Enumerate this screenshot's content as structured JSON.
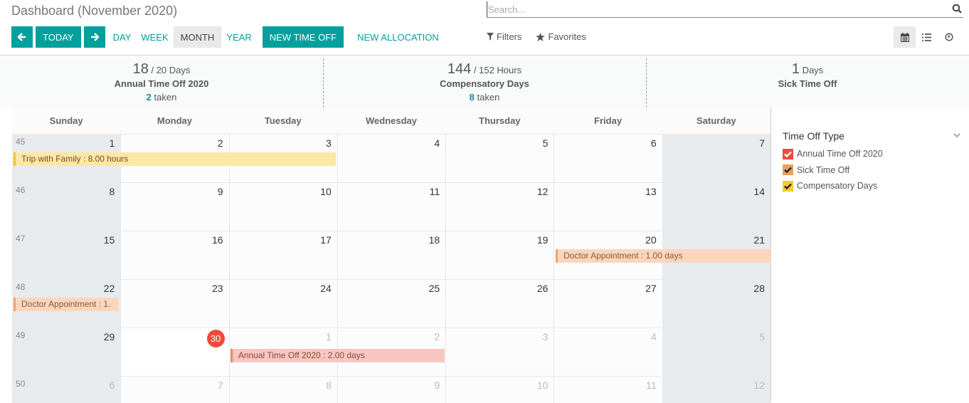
{
  "header": {
    "title": "Dashboard (November 2020)",
    "prev_label": "←",
    "today_label": "TODAY",
    "next_label": "→",
    "views": [
      "DAY",
      "WEEK",
      "MONTH",
      "YEAR"
    ],
    "active_view": "MONTH",
    "new_time_off_label": "NEW TIME OFF",
    "new_allocation_label": "NEW ALLOCATION"
  },
  "search": {
    "placeholder": "Search...",
    "value": ""
  },
  "filters": {
    "filters_label": "Filters",
    "favorites_label": "Favorites"
  },
  "view_switcher": {
    "items": [
      "calendar",
      "list",
      "activity"
    ],
    "active": "calendar"
  },
  "summary": [
    {
      "value": "18",
      "suffix": "/ 20 Days",
      "title": "Annual Time Off 2020",
      "taken": "2",
      "taken_label": "taken"
    },
    {
      "value": "144",
      "suffix": "/ 152 Hours",
      "title": "Compensatory Days",
      "taken": "8",
      "taken_label": "taken"
    },
    {
      "value": "1",
      "suffix": "Days",
      "title": "Sick Time Off",
      "taken": "",
      "taken_label": ""
    }
  ],
  "calendar": {
    "weekdays": [
      "Sunday",
      "Monday",
      "Tuesday",
      "Wednesday",
      "Thursday",
      "Friday",
      "Saturday"
    ],
    "weeks": [
      {
        "number": "45",
        "days": [
          "1",
          "2",
          "3",
          "4",
          "5",
          "6",
          "7"
        ],
        "other": [
          false,
          false,
          false,
          false,
          false,
          false,
          false
        ]
      },
      {
        "number": "46",
        "days": [
          "8",
          "9",
          "10",
          "11",
          "12",
          "13",
          "14"
        ],
        "other": [
          false,
          false,
          false,
          false,
          false,
          false,
          false
        ]
      },
      {
        "number": "47",
        "days": [
          "15",
          "16",
          "17",
          "18",
          "19",
          "20",
          "21"
        ],
        "other": [
          false,
          false,
          false,
          false,
          false,
          false,
          false
        ]
      },
      {
        "number": "48",
        "days": [
          "22",
          "23",
          "24",
          "25",
          "26",
          "27",
          "28"
        ],
        "other": [
          false,
          false,
          false,
          false,
          false,
          false,
          false
        ]
      },
      {
        "number": "49",
        "days": [
          "29",
          "30",
          "1",
          "2",
          "3",
          "4",
          "5"
        ],
        "other": [
          false,
          false,
          true,
          true,
          true,
          true,
          true
        ]
      },
      {
        "number": "50",
        "days": [
          "6",
          "7",
          "8",
          "9",
          "10",
          "11",
          "12"
        ],
        "other": [
          true,
          true,
          true,
          true,
          true,
          true,
          true
        ]
      }
    ],
    "today": "30",
    "events": [
      {
        "label": "Trip with Family : 8.00 hours",
        "color": "yellow",
        "week": 0,
        "start": 0,
        "span": 3
      },
      {
        "label": "Doctor Appointment : 1.00 days",
        "color": "orange",
        "week": 2,
        "start": 5,
        "span": 2
      },
      {
        "label": "Doctor Appointment : 1.",
        "color": "orange",
        "week": 3,
        "start": 0,
        "span": 1
      },
      {
        "label": "Annual Time Off 2020 : 2.00 days",
        "color": "red",
        "week": 4,
        "start": 2,
        "span": 2
      }
    ]
  },
  "sidebar": {
    "title": "Time Off Type",
    "items": [
      {
        "label": "Annual Time Off 2020",
        "color": "#ef4b3b",
        "check_color": "#ffffff",
        "checked": true
      },
      {
        "label": "Sick Time Off",
        "color": "#e8a05e",
        "check_color": "#222222",
        "checked": true
      },
      {
        "label": "Compensatory Days",
        "color": "#f6cc2c",
        "check_color": "#222222",
        "checked": true
      }
    ]
  },
  "colors": {
    "accent": "#00a09d",
    "today": "#ef4b3b"
  }
}
